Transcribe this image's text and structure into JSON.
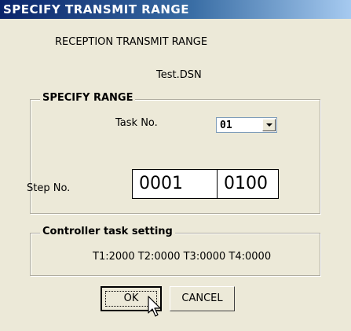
{
  "dialog": {
    "title": "SPECIFY TRANSMIT RANGE",
    "heading": "RECEPTION TRANSMIT RANGE",
    "filename": "Test.DSN"
  },
  "range_group": {
    "legend": "SPECIFY RANGE",
    "task_label": "Task No.",
    "task_value": "01",
    "step_label": "Step No.",
    "step_from": "0001",
    "step_separator": "-",
    "step_to": "0100"
  },
  "controller_group": {
    "legend": "Controller task setting",
    "value": "T1:2000 T2:0000 T3:0000 T4:0000"
  },
  "buttons": {
    "ok": "OK",
    "cancel": "CANCEL"
  },
  "icons": {
    "dropdown": "chevron-down-icon",
    "cursor": "mouse-pointer-icon"
  },
  "colors": {
    "title_start": "#0a246a",
    "title_end": "#a6caf0",
    "dialog_bg": "#ece9d8"
  }
}
